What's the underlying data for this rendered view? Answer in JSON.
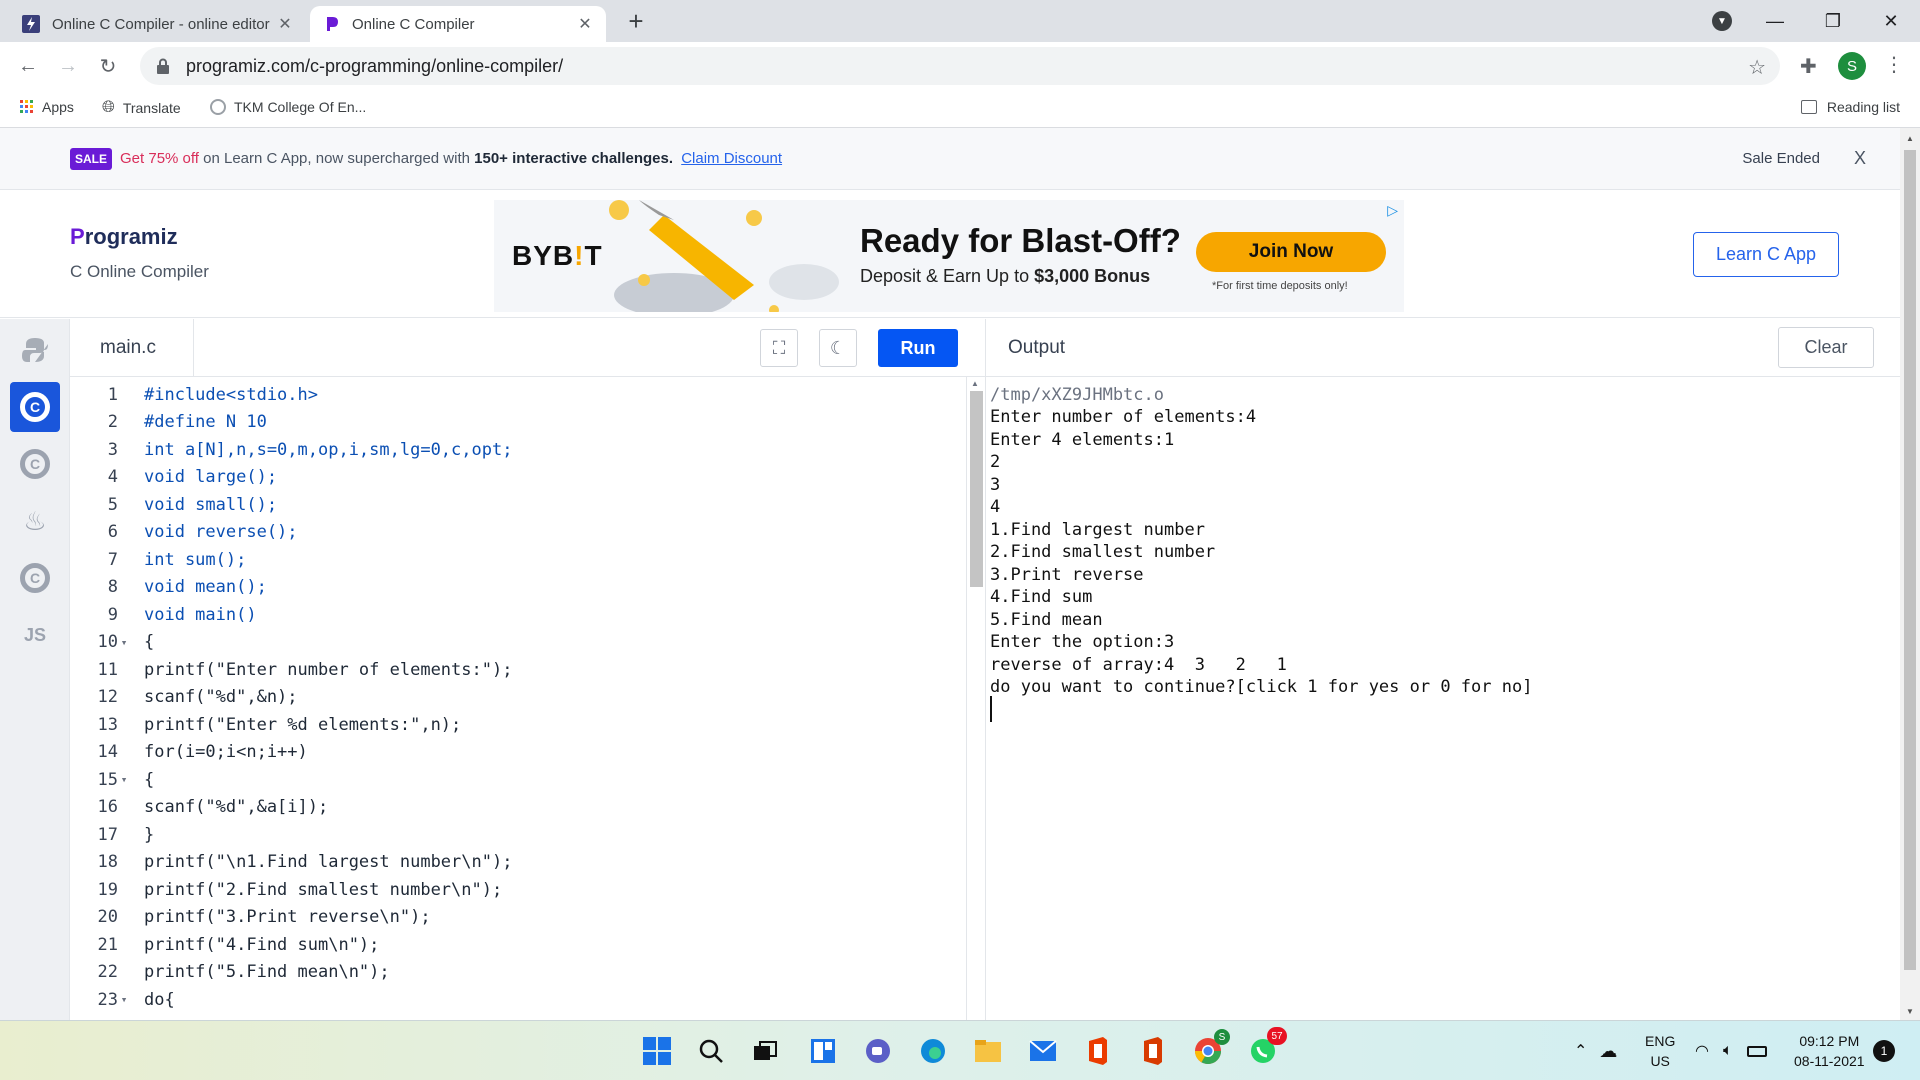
{
  "browser": {
    "tabs": [
      {
        "title": "Online C Compiler - online editor",
        "active": false
      },
      {
        "title": "Online C Compiler",
        "active": true
      }
    ],
    "address": "programiz.com/c-programming/online-compiler/",
    "profile_initial": "S",
    "bookmarks": [
      "Apps",
      "Translate",
      "TKM College Of En..."
    ],
    "reading_list": "Reading list"
  },
  "banner": {
    "badge": "SALE",
    "discount": "Get 75% off",
    "text_mid": "on Learn C App, now supercharged with",
    "bold": "150+ interactive challenges.",
    "link": "Claim Discount",
    "status": "Sale Ended",
    "close": "X"
  },
  "header": {
    "logo_first": "P",
    "logo_rest": "rogramiz",
    "subtitle": "C Online Compiler",
    "learn_button": "Learn C App"
  },
  "ad": {
    "brand_a": "BYB",
    "brand_b": "!",
    "brand_c": "T",
    "headline": "Ready for Blast-Off?",
    "sub_text": "Deposit & Earn Up to",
    "sub_bold": "$3,000 Bonus",
    "cta": "Join Now",
    "fine_print": "*For first time deposits only!"
  },
  "sidebar": {
    "languages": [
      {
        "name": "python-icon",
        "active": false
      },
      {
        "name": "c-icon",
        "active": true
      },
      {
        "name": "cpp-icon",
        "active": false
      },
      {
        "name": "java-icon",
        "active": false
      },
      {
        "name": "csharp-icon",
        "active": false
      },
      {
        "name": "js-icon",
        "label": "JS",
        "active": false
      }
    ]
  },
  "editor": {
    "filename": "main.c",
    "run_label": "Run",
    "lines": [
      {
        "n": "1",
        "code": "#include<stdio.h>"
      },
      {
        "n": "2",
        "code": "#define N 10"
      },
      {
        "n": "3",
        "code": "int a[N],n,s=0,m,op,i,sm,lg=0,c,opt;"
      },
      {
        "n": "4",
        "code": "void large();"
      },
      {
        "n": "5",
        "code": "void small();"
      },
      {
        "n": "6",
        "code": "void reverse();"
      },
      {
        "n": "7",
        "code": "int sum();"
      },
      {
        "n": "8",
        "code": "void mean();"
      },
      {
        "n": "9",
        "code": "void main()"
      },
      {
        "n": "10",
        "code": "{",
        "fold": true
      },
      {
        "n": "11",
        "code": "printf(\"Enter number of elements:\");"
      },
      {
        "n": "12",
        "code": "scanf(\"%d\",&n);"
      },
      {
        "n": "13",
        "code": "printf(\"Enter %d elements:\",n);"
      },
      {
        "n": "14",
        "code": "for(i=0;i<n;i++)"
      },
      {
        "n": "15",
        "code": "{",
        "fold": true
      },
      {
        "n": "16",
        "code": "scanf(\"%d\",&a[i]);"
      },
      {
        "n": "17",
        "code": "}"
      },
      {
        "n": "18",
        "code": "printf(\"\\n1.Find largest number\\n\");"
      },
      {
        "n": "19",
        "code": "printf(\"2.Find smallest number\\n\");"
      },
      {
        "n": "20",
        "code": "printf(\"3.Print reverse\\n\");"
      },
      {
        "n": "21",
        "code": "printf(\"4.Find sum\\n\");"
      },
      {
        "n": "22",
        "code": "printf(\"5.Find mean\\n\");"
      },
      {
        "n": "23",
        "code": "do{",
        "fold": true
      }
    ]
  },
  "output": {
    "title": "Output",
    "clear_label": "Clear",
    "lines": [
      "/tmp/xXZ9JHMbtc.o",
      "Enter number of elements:4",
      "Enter 4 elements:1",
      "2",
      "3",
      "4",
      "1.Find largest number",
      "2.Find smallest number",
      "3.Print reverse",
      "4.Find sum",
      "5.Find mean",
      "Enter the option:3",
      "reverse of array:4  3   2   1",
      "do you want to continue?[click 1 for yes or 0 for no]"
    ]
  },
  "taskbar": {
    "lang_top": "ENG",
    "lang_bottom": "US",
    "time": "09:12 PM",
    "date": "08-11-2021",
    "notifications": "1",
    "whatsapp_badge": "57",
    "chrome_badge": "S"
  }
}
